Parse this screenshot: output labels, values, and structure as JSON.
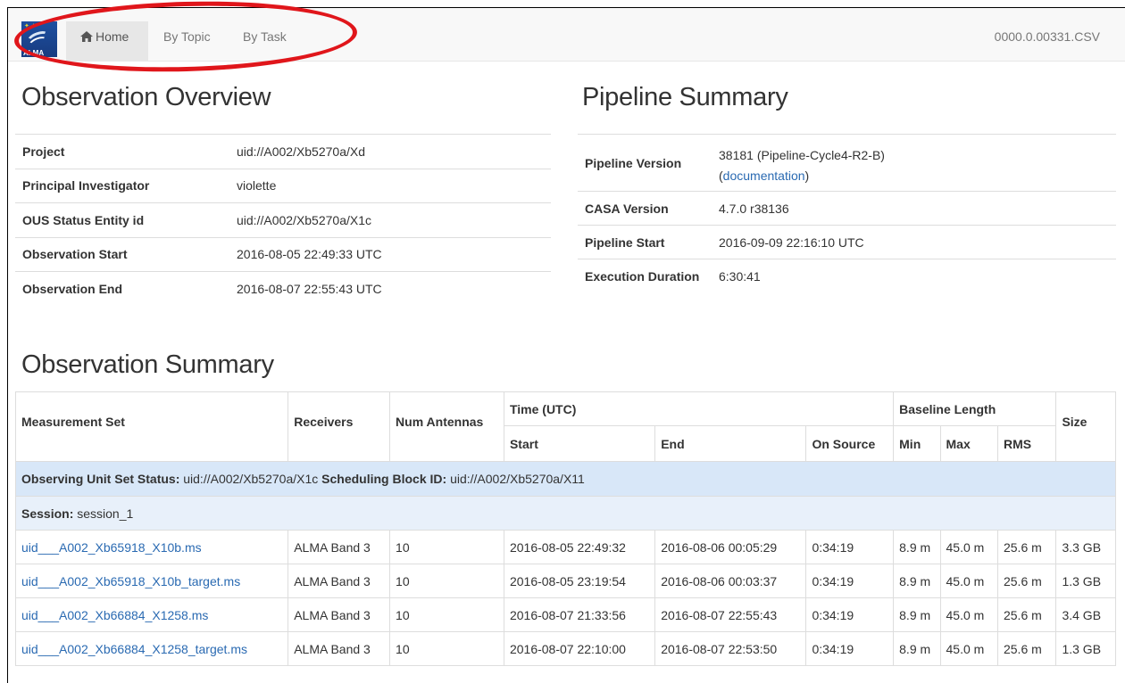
{
  "nav": {
    "logo_text": "ALMA",
    "home": "Home",
    "by_topic": "By Topic",
    "by_task": "By Task",
    "right_label": "0000.0.00331.CSV"
  },
  "overview": {
    "title": "Observation Overview",
    "rows": [
      {
        "key": "Project",
        "value": "uid://A002/Xb5270a/Xd"
      },
      {
        "key": "Principal Investigator",
        "value": "violette"
      },
      {
        "key": "OUS Status Entity id",
        "value": "uid://A002/Xb5270a/X1c"
      },
      {
        "key": "Observation Start",
        "value": "2016-08-05 22:49:33 UTC"
      },
      {
        "key": "Observation End",
        "value": "2016-08-07 22:55:43 UTC"
      }
    ]
  },
  "pipeline": {
    "title": "Pipeline Summary",
    "version_key": "Pipeline Version",
    "version_value": "38181 (Pipeline-Cycle4-R2-B)",
    "doc_open": "(",
    "doc_link": "documentation",
    "doc_close": ")",
    "casa_key": "CASA Version",
    "casa_value": "4.7.0 r38136",
    "start_key": "Pipeline Start",
    "start_value": "2016-09-09 22:16:10 UTC",
    "duration_key": "Execution Duration",
    "duration_value": "6:30:41"
  },
  "summary": {
    "title": "Observation Summary",
    "headers": {
      "measurement_set": "Measurement Set",
      "receivers": "Receivers",
      "num_antennas": "Num Antennas",
      "time_group": "Time (UTC)",
      "start": "Start",
      "end": "End",
      "on_source": "On Source",
      "baseline_group": "Baseline Length",
      "min": "Min",
      "max": "Max",
      "rms": "RMS",
      "size": "Size"
    },
    "ous_label": "Observing Unit Set Status:",
    "ous_value": "uid://A002/Xb5270a/X1c",
    "sb_label": "Scheduling Block ID:",
    "sb_value": "uid://A002/Xb5270a/X11",
    "session_label": "Session:",
    "session_value": "session_1",
    "rows": [
      {
        "ms": "uid___A002_Xb65918_X10b.ms",
        "receivers": "ALMA Band 3",
        "antennas": "10",
        "start": "2016-08-05 22:49:32",
        "end": "2016-08-06 00:05:29",
        "on_source": "0:34:19",
        "min": "8.9 m",
        "max": "45.0 m",
        "rms": "25.6 m",
        "size": "3.3 GB"
      },
      {
        "ms": "uid___A002_Xb65918_X10b_target.ms",
        "receivers": "ALMA Band 3",
        "antennas": "10",
        "start": "2016-08-05 23:19:54",
        "end": "2016-08-06 00:03:37",
        "on_source": "0:34:19",
        "min": "8.9 m",
        "max": "45.0 m",
        "rms": "25.6 m",
        "size": "1.3 GB"
      },
      {
        "ms": "uid___A002_Xb66884_X1258.ms",
        "receivers": "ALMA Band 3",
        "antennas": "10",
        "start": "2016-08-07 21:33:56",
        "end": "2016-08-07 22:55:43",
        "on_source": "0:34:19",
        "min": "8.9 m",
        "max": "45.0 m",
        "rms": "25.6 m",
        "size": "3.4 GB"
      },
      {
        "ms": "uid___A002_Xb66884_X1258_target.ms",
        "receivers": "ALMA Band 3",
        "antennas": "10",
        "start": "2016-08-07 22:10:00",
        "end": "2016-08-07 22:53:50",
        "on_source": "0:34:19",
        "min": "8.9 m",
        "max": "45.0 m",
        "rms": "25.6 m",
        "size": "1.3 GB"
      }
    ]
  },
  "colors": {
    "link": "#2a6ab2",
    "highlight_ellipse": "#e0161b",
    "ous_row": "#d8e7f8",
    "session_row": "#e8f0fa",
    "navbar": "#f8f8f8"
  }
}
